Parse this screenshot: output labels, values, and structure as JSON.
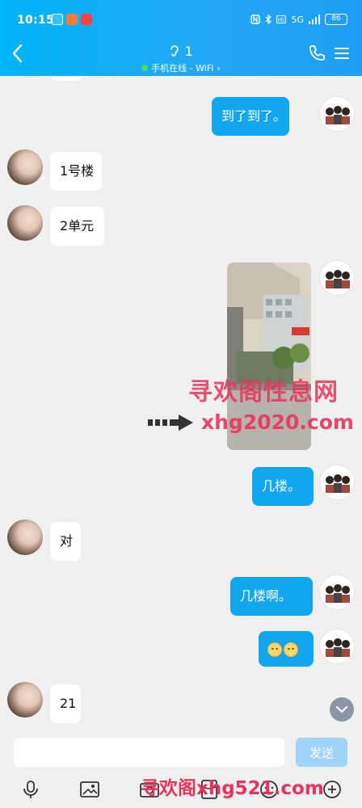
{
  "status_bar": {
    "time": "10:15",
    "net": "5G",
    "battery": "86",
    "apps": [
      "app-icon-1",
      "app-icon-2",
      "app-icon-3"
    ]
  },
  "header": {
    "title": "1",
    "subtitle": "手机在线 - WiFi",
    "subtitle_chevron": "›",
    "accent": "#12a6ef"
  },
  "messages": [
    {
      "side": "out",
      "text": "到了到了。"
    },
    {
      "side": "in",
      "text": "1号楼"
    },
    {
      "side": "in",
      "text": "2单元"
    },
    {
      "side": "out",
      "type": "image"
    },
    {
      "side": "out",
      "text": "几楼。"
    },
    {
      "side": "in",
      "text": "对"
    },
    {
      "side": "out",
      "text": "几楼啊。"
    },
    {
      "side": "out",
      "type": "emoji",
      "emoji": [
        "grimace-emoji",
        "grimace-emoji"
      ]
    },
    {
      "side": "in",
      "text": "21"
    }
  ],
  "watermarks": {
    "line1": "寻欢阁性息网",
    "line2": "xhg2020.com",
    "line3": "寻欢阁xhg521.com"
  },
  "input": {
    "value": "",
    "send_label": "发送"
  },
  "toolbar_icons": [
    "mic-icon",
    "image-icon",
    "camera-icon",
    "red-packet-icon",
    "emoji-icon",
    "plus-icon"
  ]
}
